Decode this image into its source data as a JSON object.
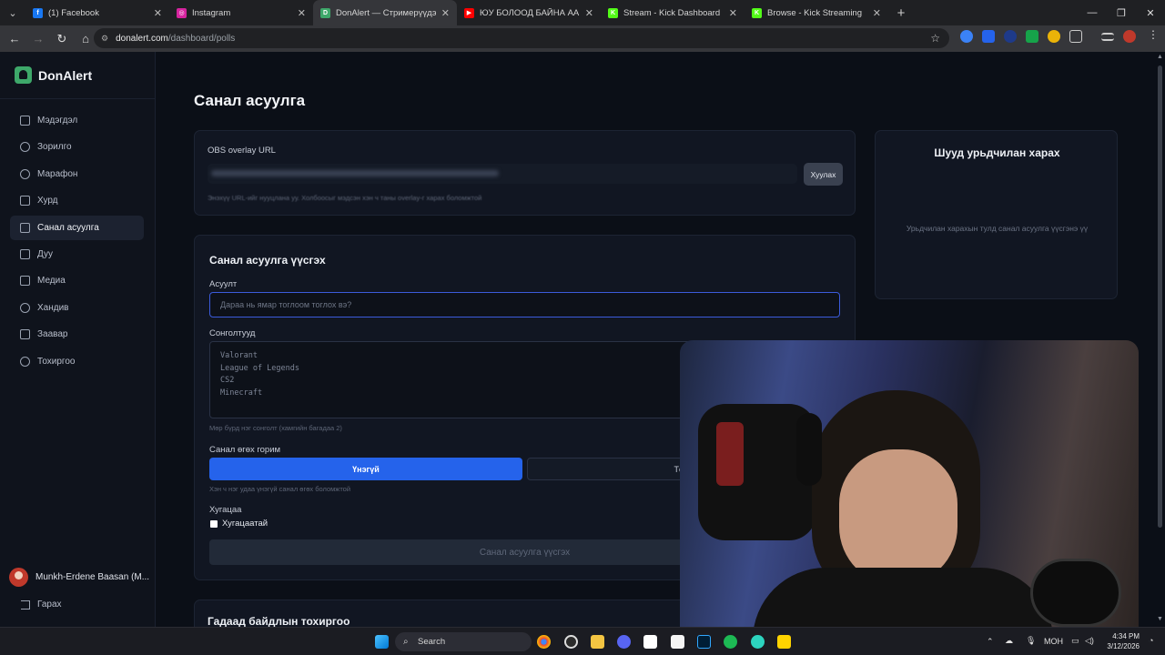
{
  "browser": {
    "tabs": [
      {
        "title": "(1) Facebook",
        "color": "#1877f2",
        "glyph": "f",
        "active": false
      },
      {
        "title": "Instagram",
        "color": "#d6249f",
        "glyph": "◎",
        "active": false
      },
      {
        "title": "DonAlert — Стримерүүдэд зор",
        "color": "#3ea86a",
        "glyph": "D",
        "active": true
      },
      {
        "title": "ЮУ БОЛООД БАЙНА АА - YouTube",
        "color": "#ff0000",
        "glyph": "▶",
        "active": false
      },
      {
        "title": "Stream - Kick Dashboard",
        "color": "#53fc18",
        "glyph": "K",
        "active": false
      },
      {
        "title": "Browse - Kick Streaming",
        "color": "#53fc18",
        "glyph": "K",
        "active": false
      }
    ],
    "url_host": "donalert.com",
    "url_path": "/dashboard/polls"
  },
  "sidebar": {
    "brand": "DonAlert",
    "items": [
      {
        "label": "Мэдэгдэл",
        "icon": "bell-icon",
        "active": false
      },
      {
        "label": "Зорилго",
        "icon": "target-icon",
        "active": false
      },
      {
        "label": "Марафон",
        "icon": "clock-icon",
        "active": false
      },
      {
        "label": "Хурд",
        "icon": "heart-pulse-icon",
        "active": false
      },
      {
        "label": "Санал асуулга",
        "icon": "poll-icon",
        "active": true
      },
      {
        "label": "Дуу",
        "icon": "music-icon",
        "active": false
      },
      {
        "label": "Медиа",
        "icon": "play-icon",
        "active": false
      },
      {
        "label": "Хандив",
        "icon": "heart-icon",
        "active": false
      },
      {
        "label": "Заавар",
        "icon": "book-icon",
        "active": false
      },
      {
        "label": "Тохиргоо",
        "icon": "gear-icon",
        "active": false
      }
    ],
    "user_name": "Munkh-Erdene Baasan (M...",
    "logout": "Гарах"
  },
  "main": {
    "title": "Санал асуулга",
    "obs": {
      "label": "OBS overlay URL",
      "copy_button": "Хуулах",
      "hint": "Энэхүү URL-ийг нууцлана уу. Холбоосыг мэдсэн хэн ч таны overlay-г харах боломжтой"
    },
    "preview": {
      "title": "Шууд урьдчилан харах",
      "empty_text": "Урьдчилан харахын тулд санал асуулга үүсгэнэ үү"
    },
    "create": {
      "title": "Санал асуулга үүсгэх",
      "question_label": "Асуулт",
      "question_placeholder": "Дараа нь ямар тоглоом тоглох вэ?",
      "options_label": "Сонголтууд",
      "options": [
        "Valorant",
        "League of Legends",
        "CS2",
        "Minecraft"
      ],
      "options_hint": "Мөр бүрд нэг сонголт (хамгийн багадаа 2)",
      "mode_label": "Санал өгөх горим",
      "mode_free": "Үнэгүй",
      "mode_paid": "Төлб",
      "mode_hint": "Хэн ч нэг удаа үнэгүй санал өгөх боломжтой",
      "duration_label": "Хугацаа",
      "duration_checkbox": "Хугацаатай",
      "submit": "Санал асуулга үүсгэх"
    },
    "next_section_title": "Гадаад байдлын тохиргоо"
  },
  "taskbar": {
    "search": "Search",
    "lang": "МОН",
    "time": "4:34 PM",
    "date": "3/12/2026"
  }
}
